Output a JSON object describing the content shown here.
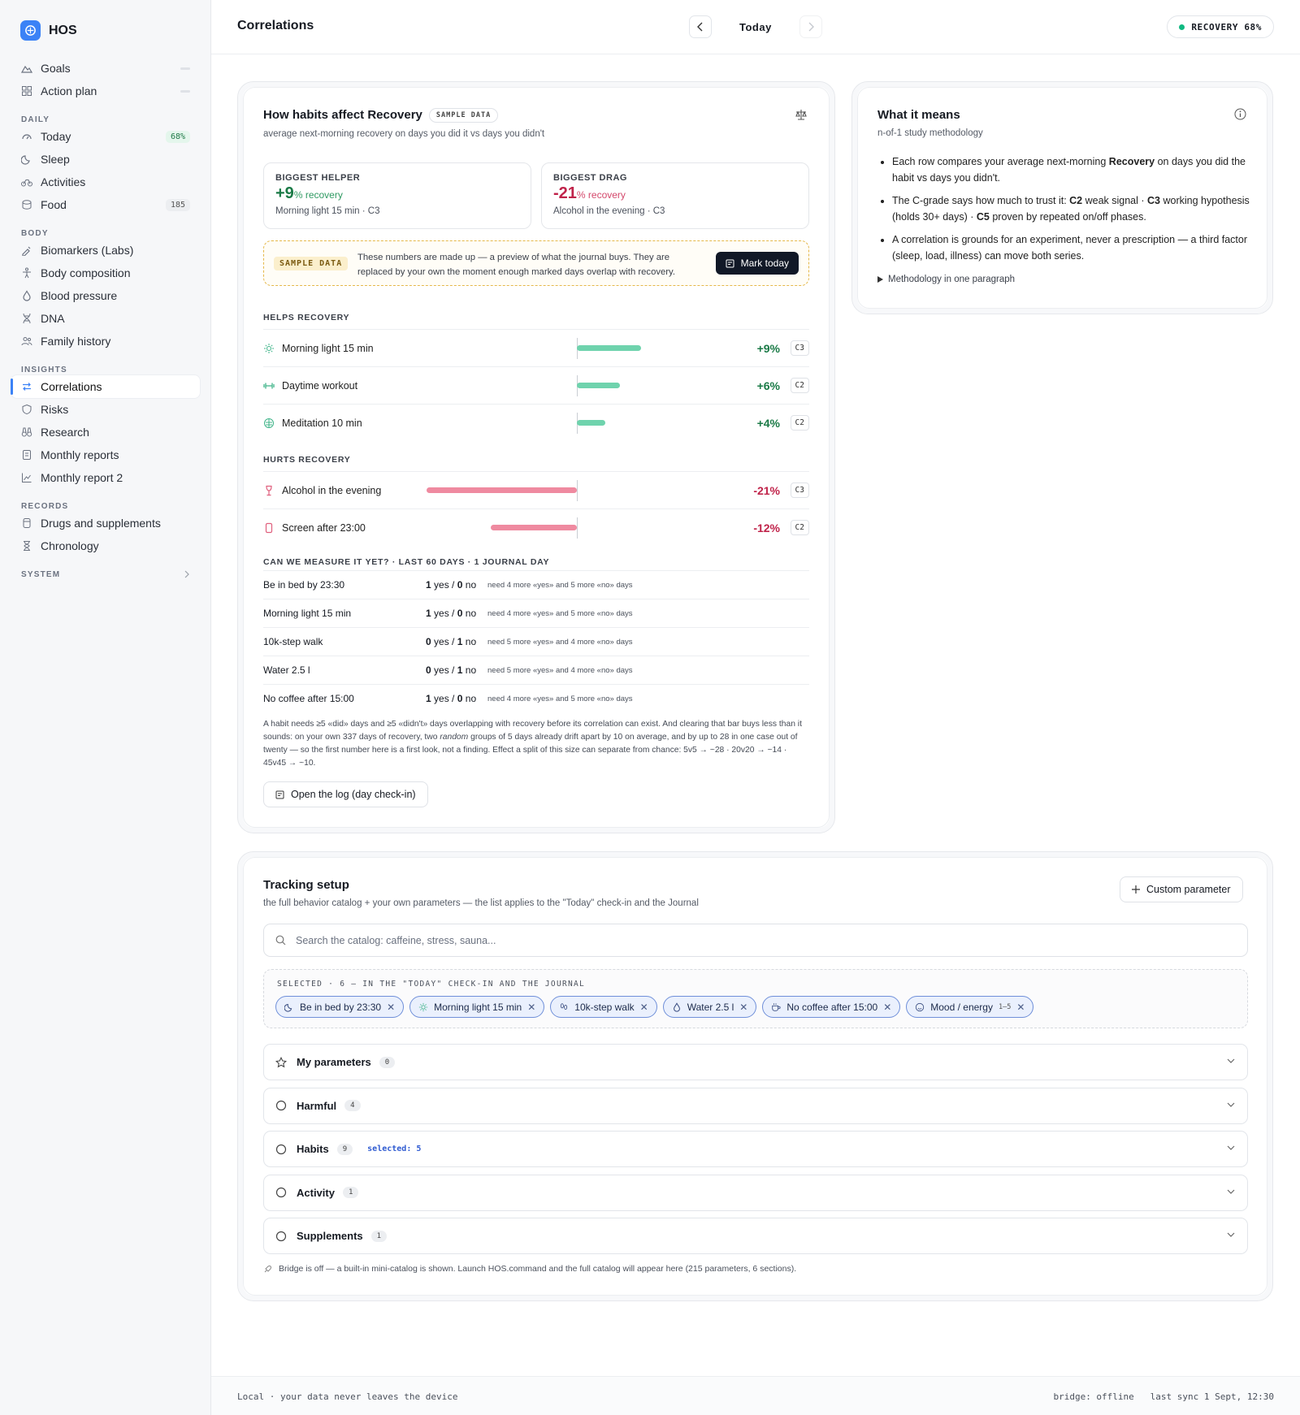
{
  "app": {
    "name": "HOS"
  },
  "sidebar": {
    "top": [
      {
        "label": "Goals",
        "icon": "mountain-icon",
        "badge": ""
      },
      {
        "label": "Action plan",
        "icon": "grid-icon",
        "badge": ""
      }
    ],
    "sections": [
      {
        "title": "DAILY",
        "items": [
          {
            "label": "Today",
            "icon": "gauge-icon",
            "badge": "68%"
          },
          {
            "label": "Sleep",
            "icon": "moon-icon",
            "badge": ""
          },
          {
            "label": "Activities",
            "icon": "bike-icon",
            "badge": ""
          },
          {
            "label": "Food",
            "icon": "food-icon",
            "badge": "185"
          }
        ]
      },
      {
        "title": "BODY",
        "items": [
          {
            "label": "Biomarkers (Labs)",
            "icon": "pipette-icon"
          },
          {
            "label": "Body composition",
            "icon": "body-icon"
          },
          {
            "label": "Blood pressure",
            "icon": "drop-icon"
          },
          {
            "label": "DNA",
            "icon": "dna-icon"
          },
          {
            "label": "Family history",
            "icon": "users-icon"
          }
        ]
      },
      {
        "title": "INSIGHTS",
        "items": [
          {
            "label": "Correlations",
            "icon": "arrows-icon"
          },
          {
            "label": "Risks",
            "icon": "shield-icon"
          },
          {
            "label": "Research",
            "icon": "binoculars-icon"
          },
          {
            "label": "Monthly reports",
            "icon": "report-icon"
          },
          {
            "label": "Monthly report 2",
            "icon": "chart-icon"
          }
        ]
      },
      {
        "title": "RECORDS",
        "items": [
          {
            "label": "Drugs and supplements",
            "icon": "pill-icon"
          },
          {
            "label": "Chronology",
            "icon": "hourglass-icon"
          }
        ]
      },
      {
        "title": "SYSTEM",
        "items": []
      }
    ]
  },
  "header": {
    "title": "Correlations",
    "date": "Today",
    "recovery": "RECOVERY 68%"
  },
  "habits": {
    "title": "How habits affect Recovery",
    "tag": "SAMPLE DATA",
    "subtitle": "average next-morning recovery on days you did it vs days you didn't",
    "helper": {
      "label": "BIGGEST HELPER",
      "value": "+9",
      "unit": "% recovery",
      "detail": "Morning light 15 min · C3"
    },
    "drag": {
      "label": "BIGGEST DRAG",
      "value": "-21",
      "unit": "% recovery",
      "detail": "Alcohol in the evening · C3"
    },
    "sample": {
      "tag": "SAMPLE DATA",
      "text": "These numbers are made up — a preview of what the journal buys. They are replaced by your own the moment enough marked days overlap with recovery.",
      "button": "Mark today"
    },
    "helps_title": "HELPS RECOVERY",
    "helps": [
      {
        "name": "Morning light 15 min",
        "pct": "+9%",
        "value": 9,
        "grade": "C3",
        "icon": "sun-icon"
      },
      {
        "name": "Daytime workout",
        "pct": "+6%",
        "value": 6,
        "grade": "C2",
        "icon": "dumbbell-icon"
      },
      {
        "name": "Meditation 10 min",
        "pct": "+4%",
        "value": 4,
        "grade": "C2",
        "icon": "brain-icon"
      }
    ],
    "hurts_title": "HURTS RECOVERY",
    "hurts": [
      {
        "name": "Alcohol in the evening",
        "pct": "-21%",
        "value": -21,
        "grade": "C3",
        "icon": "wine-icon"
      },
      {
        "name": "Screen after 23:00",
        "pct": "-12%",
        "value": -12,
        "grade": "C2",
        "icon": "phone-icon"
      }
    ],
    "measure_title": "CAN WE MEASURE IT YET? · LAST 60 DAYS · 1 JOURNAL DAY",
    "measure": [
      {
        "name": "Be in bed by 23:30",
        "yes": "1",
        "no": "0",
        "need": "need 4 more «yes» and 5 more «no» days"
      },
      {
        "name": "Morning light 15 min",
        "yes": "1",
        "no": "0",
        "need": "need 4 more «yes» and 5 more «no» days"
      },
      {
        "name": "10k-step walk",
        "yes": "0",
        "no": "1",
        "need": "need 5 more «yes» and 4 more «no» days"
      },
      {
        "name": "Water 2.5 l",
        "yes": "0",
        "no": "1",
        "need": "need 5 more «yes» and 4 more «no» days"
      },
      {
        "name": "No coffee after 15:00",
        "yes": "1",
        "no": "0",
        "need": "need 4 more «yes» and 5 more «no» days"
      }
    ],
    "yes_label": "yes",
    "no_label": "no",
    "note_a": "A habit needs ≥5 «did» days and ≥5 «didn't» days overlapping with recovery before its correlation can exist. And clearing that bar buys less than it sounds: on your own 337 days of recovery, two ",
    "note_em": "random",
    "note_b": " groups of 5 days already drift apart by 10 on average, and by up to 28 in one case out of twenty — so the first number here is a first look, not a finding. Effect a split of this size can separate from chance: 5v5 → ~28 · 20v20 → ~14 · 45v45 → ~10.",
    "log_button": "Open the log (day check-in)"
  },
  "means": {
    "title": "What it means",
    "subtitle": "n-of-1 study methodology",
    "b1a": "Each row compares your average next-morning ",
    "b1b": "Recovery",
    "b1c": " on days you did the habit vs days you didn't.",
    "b2a": "The C-grade says how much to trust it: ",
    "b2b": "C2",
    "b2c": " weak signal · ",
    "b2d": "C3",
    "b2e": " working hypothesis (holds 30+ days) · ",
    "b2f": "C5",
    "b2g": " proven by repeated on/off phases.",
    "b3": "A correlation is grounds for an experiment, never a prescription — a third factor (sleep, load, illness) can move both series.",
    "method": "Methodology in one paragraph"
  },
  "tracking": {
    "title": "Tracking setup",
    "subtitle": "the full behavior catalog + your own parameters — the list applies to the \"Today\" check-in and the Journal",
    "custom_button": "Custom parameter",
    "search_placeholder": "Search the catalog: caffeine, stress, sauna...",
    "selected_title": "SELECTED · 6 — IN THE \"TODAY\" CHECK-IN AND THE JOURNAL",
    "pills": [
      {
        "label": "Be in bed by 23:30",
        "extra": "",
        "icon": "moon-icon"
      },
      {
        "label": "Morning light 15 min",
        "extra": "",
        "icon": "sun-icon"
      },
      {
        "label": "10k-step walk",
        "extra": "",
        "icon": "footprints-icon"
      },
      {
        "label": "Water 2.5 l",
        "extra": "",
        "icon": "drop-icon"
      },
      {
        "label": "No coffee after 15:00",
        "extra": "",
        "icon": "cup-icon"
      },
      {
        "label": "Mood / energy",
        "extra": "1–5",
        "icon": "smile-icon"
      }
    ],
    "groups": [
      {
        "label": "My parameters",
        "count": "0",
        "selected": "",
        "icon": "star-icon"
      },
      {
        "label": "Harmful",
        "count": "4",
        "selected": "",
        "icon": "circle-icon"
      },
      {
        "label": "Habits",
        "count": "9",
        "selected": "selected: 5",
        "icon": "circle-icon"
      },
      {
        "label": "Activity",
        "count": "1",
        "selected": "",
        "icon": "circle-icon"
      },
      {
        "label": "Supplements",
        "count": "1",
        "selected": "",
        "icon": "circle-icon"
      }
    ],
    "bridge_note": "Bridge is off — a built-in mini-catalog is shown. Launch HOS.command and the full catalog will appear here (215 parameters, 6 sections)."
  },
  "footer": {
    "left": "Local · your data never leaves the device",
    "bridge": "bridge: offline",
    "sync": "last sync 1 Sept, 12:30"
  },
  "colors": {
    "accent": "#3b82f6",
    "positive": "#1a7a46",
    "negative": "#c0234a",
    "bar_pos": "#6fd3ad",
    "bar_neg": "#ef8aa0"
  }
}
